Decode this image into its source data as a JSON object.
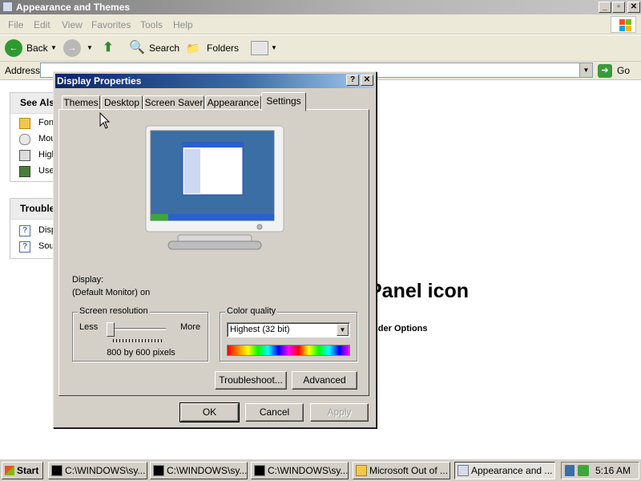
{
  "explorer": {
    "title": "Appearance and Themes",
    "menu": [
      "File",
      "Edit",
      "View",
      "Favorites",
      "Tools",
      "Help"
    ],
    "toolbar": {
      "back": "Back",
      "search": "Search",
      "folders": "Folders"
    },
    "address": {
      "label": "Address",
      "go": "Go"
    },
    "see_also": {
      "header": "See Als",
      "items": [
        "Fon",
        "Mou",
        "High",
        "Use"
      ]
    },
    "troubleshooters": {
      "header": "Trouble",
      "items": [
        "Disp",
        "Sou"
      ]
    },
    "main_heading": "Panel icon",
    "main_link": "older Options"
  },
  "dialog": {
    "title": "Display Properties",
    "help_btn": "?",
    "close_btn": "✕",
    "tabs": [
      "Themes",
      "Desktop",
      "Screen Saver",
      "Appearance",
      "Settings"
    ],
    "active_tab": "Settings",
    "display_label": "Display:",
    "display_value": "(Default Monitor) on",
    "resolution": {
      "legend": "Screen resolution",
      "less": "Less",
      "more": "More",
      "value_text": "800 by 600 pixels",
      "slider_level": 0
    },
    "color_quality": {
      "legend": "Color quality",
      "selected": "Highest (32 bit)"
    },
    "buttons": {
      "troubleshoot": "Troubleshoot...",
      "advanced": "Advanced",
      "ok": "OK",
      "cancel": "Cancel",
      "apply": "Apply"
    }
  },
  "taskbar": {
    "start": "Start",
    "tasks": [
      "C:\\WINDOWS\\sy...",
      "C:\\WINDOWS\\sy...",
      "C:\\WINDOWS\\sy...",
      "Microsoft Out of ...",
      "Appearance and ..."
    ],
    "clock": "5:16 AM"
  },
  "colors": {
    "dialog_title": "#0a246a",
    "face": "#d4d0c8",
    "desktop_preview": "#3a6ea5"
  }
}
